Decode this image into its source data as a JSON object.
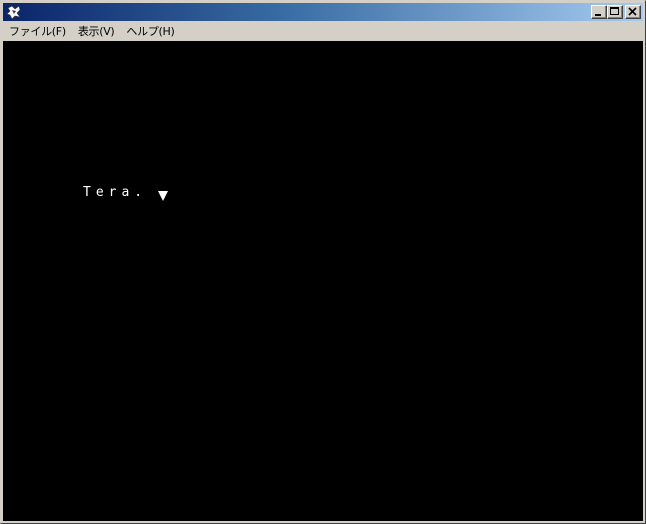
{
  "window": {
    "title": "",
    "title_buttons": [
      {
        "name": "minimize",
        "icon": "minimize-icon"
      },
      {
        "name": "maximize",
        "icon": "maximize-icon"
      },
      {
        "name": "close",
        "icon": "close-icon"
      }
    ]
  },
  "menu": {
    "items": [
      {
        "label": "ファイル(F)"
      },
      {
        "label": "表示(V)"
      },
      {
        "label": "ヘルプ(H)"
      }
    ]
  },
  "content": {
    "message": "Tera.",
    "cursor_icon": "triangle-down-icon",
    "text_color": "#ffffff",
    "background_color": "#000000"
  },
  "colors": {
    "titlebar_start": "#0a246a",
    "titlebar_end": "#a6caf0",
    "chrome": "#d4d0c8"
  }
}
